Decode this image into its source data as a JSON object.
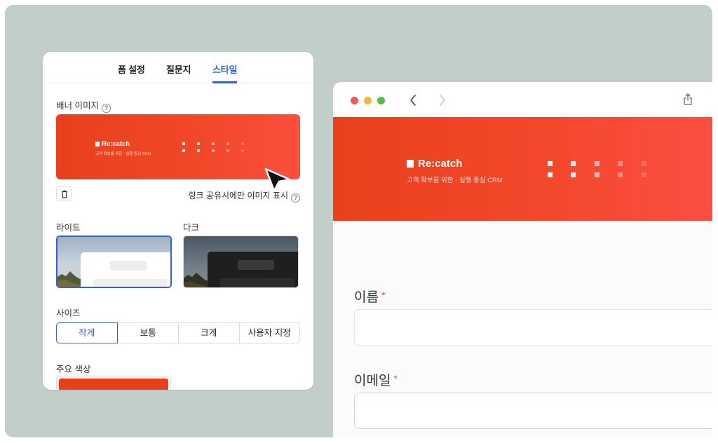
{
  "settings_panel": {
    "tabs": [
      {
        "label": "폼 설정"
      },
      {
        "label": "질문지"
      },
      {
        "label": "스타일",
        "active": true
      }
    ],
    "banner_image_label": "배너 이미지",
    "help_icon": "?",
    "banner_preview": {
      "brand": "Re:catch",
      "tagline": "고객 확보를 위한 · 실행 중심 CRM"
    },
    "link_share_note": "링크 공유시에만 이미지 표시",
    "themes": [
      {
        "label": "라이트",
        "selected": true
      },
      {
        "label": "다크",
        "selected": false
      }
    ],
    "size_label": "사이즈",
    "size_options": [
      "작게",
      "보통",
      "크게",
      "사용자 지정"
    ],
    "size_selected": "작게",
    "main_color_label": "주요 색상",
    "main_color": "#e8401d",
    "accent_color": "#3163c8"
  },
  "browser_preview": {
    "window_buttons": [
      "close",
      "minimize",
      "maximize"
    ],
    "brand": "Re:catch",
    "tagline": "고객 확보를 위한 · 실행 중심 CRM",
    "fields": [
      {
        "label": "이름",
        "required_mark": "*"
      },
      {
        "label": "이메일",
        "required_mark": "*"
      }
    ]
  },
  "icons": [
    "help-icon",
    "trash-icon",
    "back-arrow-icon",
    "forward-arrow-icon",
    "share-icon",
    "mouse-cursor-icon"
  ]
}
